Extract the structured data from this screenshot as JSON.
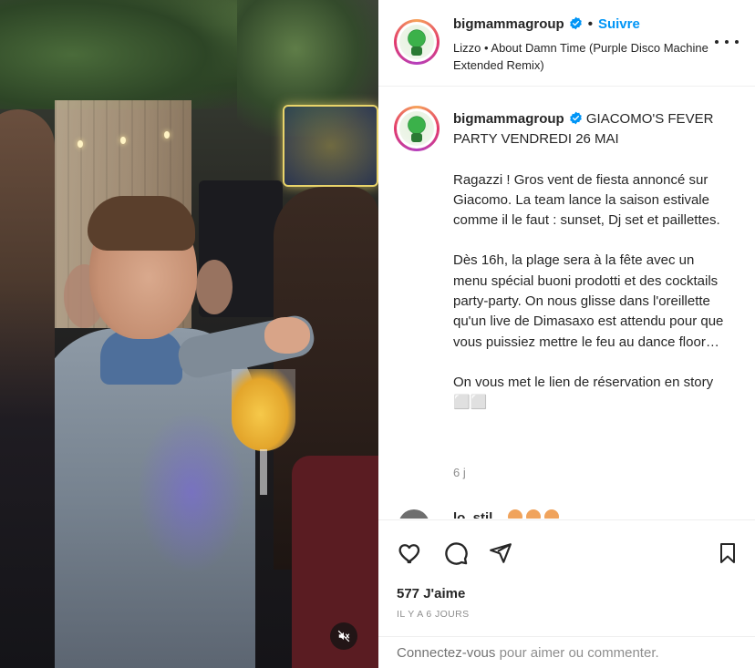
{
  "colors": {
    "accent_blue": "#0095f6",
    "text_primary": "#262626",
    "text_secondary": "#8e8e8e",
    "divider": "#efefef"
  },
  "media": {
    "mute_icon": "speaker-muted-icon"
  },
  "header": {
    "username": "bigmammagroup",
    "verified_icon": "verified-badge-icon",
    "separator": "•",
    "follow_label": "Suivre",
    "song": "Lizzo • About Damn Time (Purple Disco Machine Extended Remix)",
    "more_icon": "more-options-icon"
  },
  "caption": {
    "username": "bigmammagroup",
    "headline": "GIACOMO'S FEVER PARTY VENDREDI 26 MAI",
    "paragraphs": [
      "Ragazzi ! Gros vent de fiesta annoncé sur Giacomo. La team lance la saison estivale comme il le faut : sunset, Dj set et paillettes.",
      "Dès 16h, la plage sera à la fête avec un menu spécial buoni prodotti et des cocktails party-party. On nous glisse dans l'oreillette qu'un live de Dimasaxo est attendu pour que vous puissiez mettre le feu au dance floor…",
      "On vous met le lien de réservation en story ⬜⬜"
    ],
    "time": "6 j"
  },
  "comment_peek": {
    "text": "lo_stil..."
  },
  "actions": {
    "icons": [
      "heart-icon",
      "comment-icon",
      "share-icon",
      "bookmark-icon"
    ],
    "likes": "577 J'aime",
    "posted": "IL Y A 6 JOURS",
    "login_link": "Connectez-vous",
    "login_rest": " pour aimer ou commenter."
  }
}
